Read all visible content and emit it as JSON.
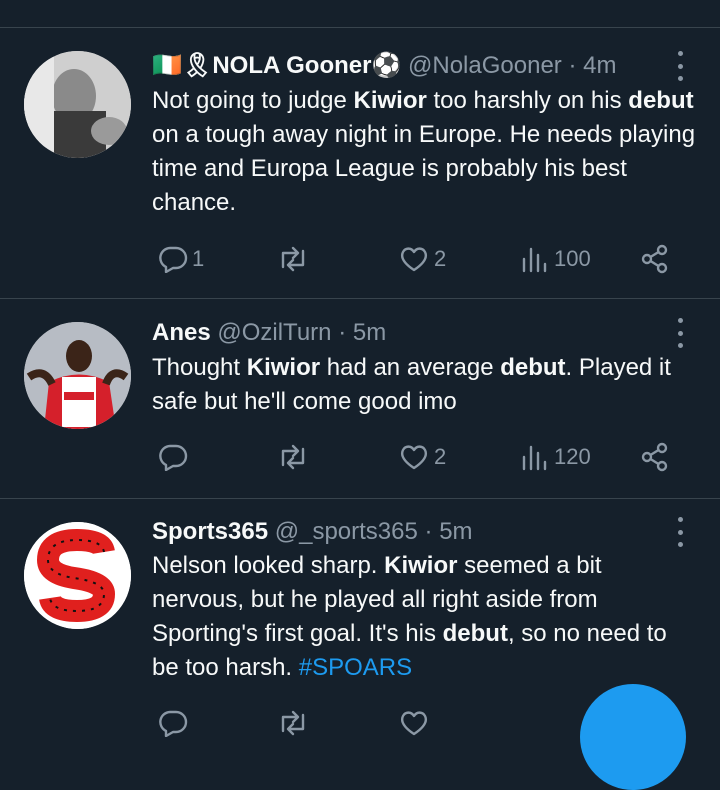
{
  "tweets": [
    {
      "name": "🇮🇪🎗NOLA Gooner⚽",
      "handle": "@NolaGooner",
      "dot": "·",
      "time": "4m",
      "body": [
        {
          "t": "Not going to judge "
        },
        {
          "t": "Kiwior",
          "b": true
        },
        {
          "t": " too harshly on his "
        },
        {
          "t": "debut",
          "b": true
        },
        {
          "t": " on a tough away night in Europe. He needs playing time and Europa League is probably his best chance."
        }
      ],
      "replies": "1",
      "retweets": "",
      "likes": "2",
      "views": "100"
    },
    {
      "name": "Anes",
      "handle": "@OzilTurn",
      "dot": "·",
      "time": "5m",
      "body": [
        {
          "t": "Thought "
        },
        {
          "t": "Kiwior",
          "b": true
        },
        {
          "t": " had an average "
        },
        {
          "t": "debut",
          "b": true
        },
        {
          "t": ". Played it safe but he'll come good imo"
        }
      ],
      "replies": "",
      "retweets": "",
      "likes": "2",
      "views": "120"
    },
    {
      "name": "Sports365",
      "handle": "@_sports365",
      "dot": "·",
      "time": "5m",
      "body": [
        {
          "t": "Nelson looked sharp. "
        },
        {
          "t": "Kiwior",
          "b": true
        },
        {
          "t": " seemed a bit nervous, but he played all right aside from Sporting's first goal. It's his "
        },
        {
          "t": "debut",
          "b": true
        },
        {
          "t": ", so no need to be too harsh. "
        },
        {
          "t": "#SPOARS",
          "h": true
        }
      ],
      "replies": "",
      "retweets": "",
      "likes": "",
      "views": ""
    }
  ],
  "colors": {
    "background": "#15202b",
    "divider": "#38444d",
    "text": "#f7f9f9",
    "muted": "#8b98a5",
    "accent": "#1d9bf0"
  },
  "icons": [
    "reply-icon",
    "retweet-icon",
    "like-icon",
    "views-icon",
    "share-icon",
    "more-icon",
    "compose-fab"
  ]
}
